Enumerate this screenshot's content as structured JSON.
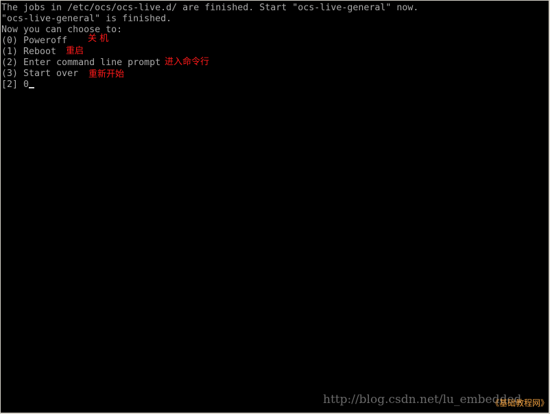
{
  "terminal": {
    "lines": [
      "The jobs in /etc/ocs/ocs-live.d/ are finished. Start \"ocs-live-general\" now.",
      "\"ocs-live-general\" is finished.",
      "Now you can choose to:",
      "(0) Poweroff",
      "(1) Reboot",
      "(2) Enter command line prompt",
      "(3) Start over"
    ],
    "prompt": "[2] ",
    "input_value": "0"
  },
  "annotations": {
    "poweroff": "关 机",
    "reboot": "重启",
    "command_line": "进入命令行",
    "start_over": "重新开始"
  },
  "watermark": {
    "url": "http://blog.csdn.net/lu_embedded",
    "site": "《基础教程网》"
  },
  "colors": {
    "background": "#000000",
    "text": "#aaaaaa",
    "annotation": "#ff1a1a"
  }
}
